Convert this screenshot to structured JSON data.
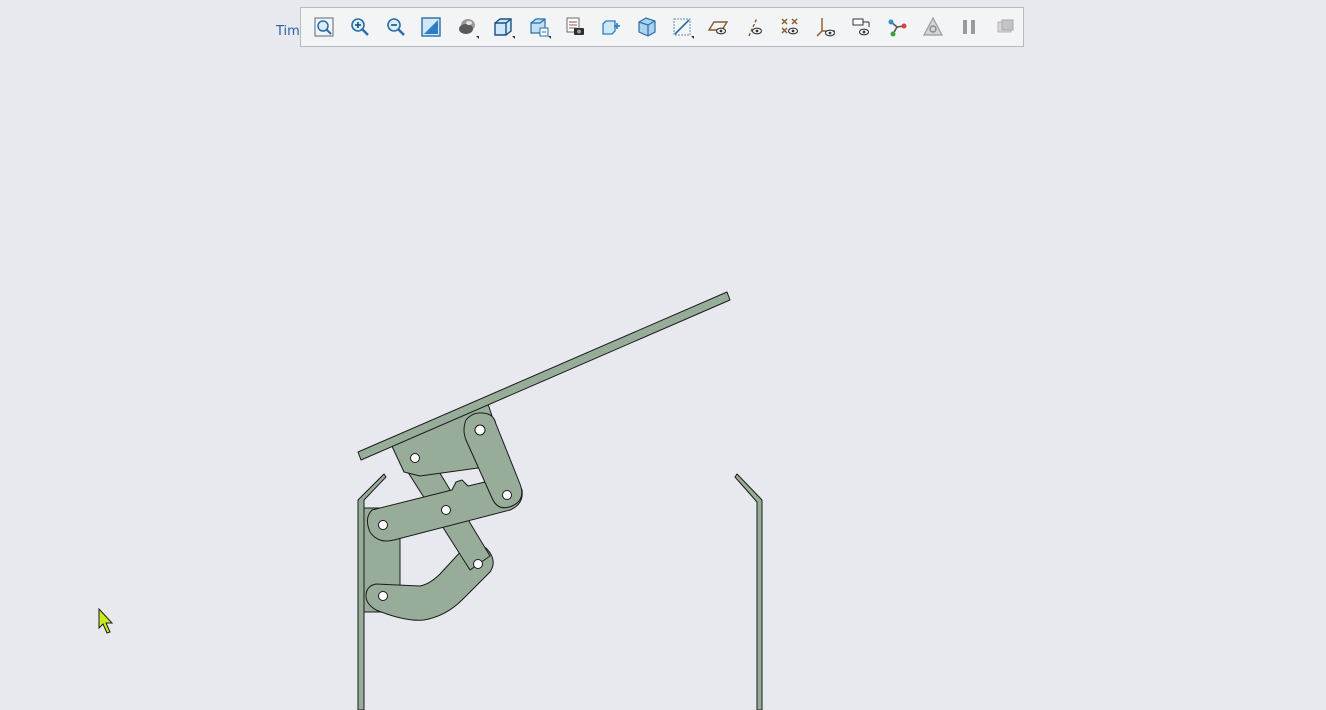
{
  "header": {
    "timer_label": "Tim"
  },
  "toolbar": {
    "buttons": [
      {
        "icon": "zoom-fit-icon"
      },
      {
        "icon": "zoom-in-icon"
      },
      {
        "icon": "zoom-out-icon"
      },
      {
        "icon": "zoom-window-icon"
      },
      {
        "icon": "display-style-icon",
        "flyout": true
      },
      {
        "icon": "view-orientation-icon",
        "flyout": true
      },
      {
        "icon": "saved-views-icon",
        "flyout": true
      },
      {
        "icon": "view-manager-icon"
      },
      {
        "icon": "add-view-icon"
      },
      {
        "icon": "perspective-icon"
      },
      {
        "icon": "section-view-icon",
        "flyout": true
      },
      {
        "icon": "plane-display-icon"
      },
      {
        "icon": "axis-display-icon"
      },
      {
        "icon": "point-display-icon"
      },
      {
        "icon": "csys-display-icon"
      },
      {
        "icon": "annotation-display-icon"
      },
      {
        "icon": "mechanism-connections-icon"
      },
      {
        "icon": "mechanism-display-icon"
      },
      {
        "icon": "pause-icon"
      },
      {
        "icon": "stop-icon"
      }
    ]
  },
  "colors": {
    "background": "#e8e9ee",
    "part_fill": "#97ad99",
    "part_stroke": "#1a1a1a",
    "cursor_fill": "#c8ea1e"
  }
}
